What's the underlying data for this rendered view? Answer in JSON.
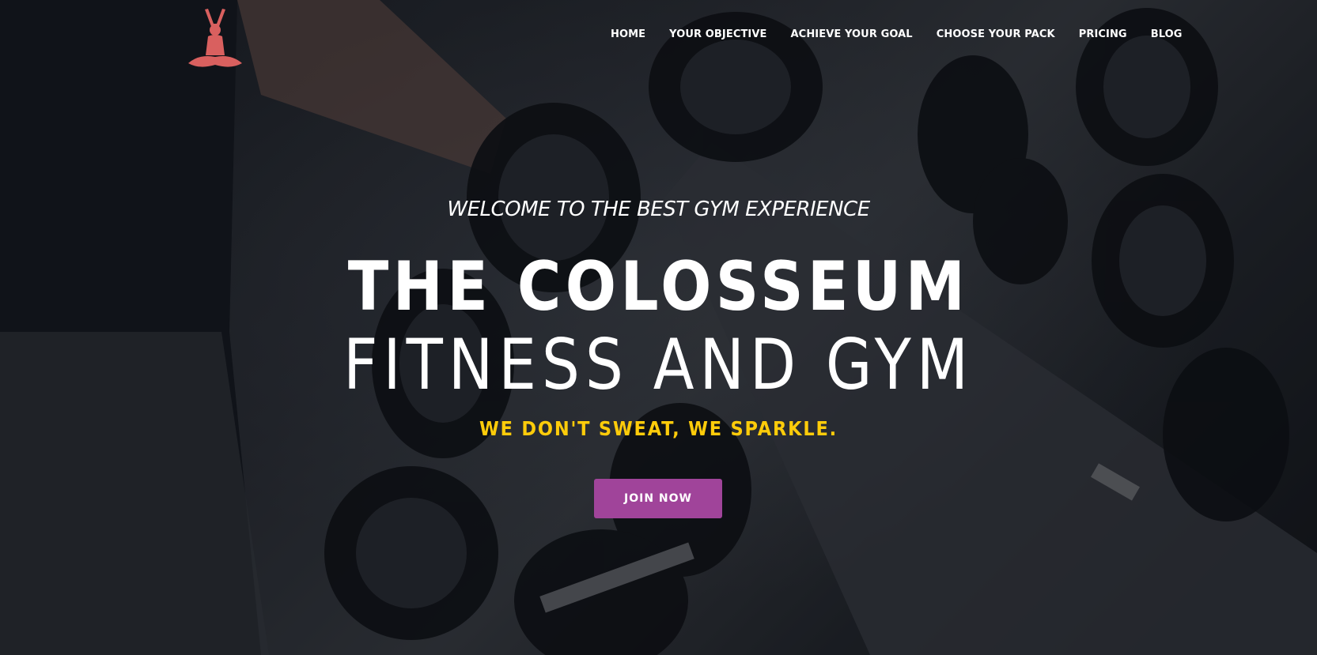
{
  "brand": {
    "logo_icon": "yoga-figure-icon",
    "logo_color": "#d9605f"
  },
  "nav": {
    "items": [
      {
        "label": "HOME"
      },
      {
        "label": "YOUR OBJECTIVE"
      },
      {
        "label": "ACHIEVE YOUR GOAL"
      },
      {
        "label": "CHOOSE YOUR PACK"
      },
      {
        "label": "PRICING"
      },
      {
        "label": "BLOG"
      }
    ]
  },
  "hero": {
    "welcome": "WELCOME TO THE BEST GYM EXPERIENCE",
    "title_line1": "THE COLOSSEUM",
    "title_line2": "FITNESS AND GYM",
    "tagline": "WE DON'T SWEAT, WE SPARKLE.",
    "cta_label": "JOIN NOW",
    "cta_color": "#a0449a",
    "tagline_color": "#ffcc0a"
  }
}
